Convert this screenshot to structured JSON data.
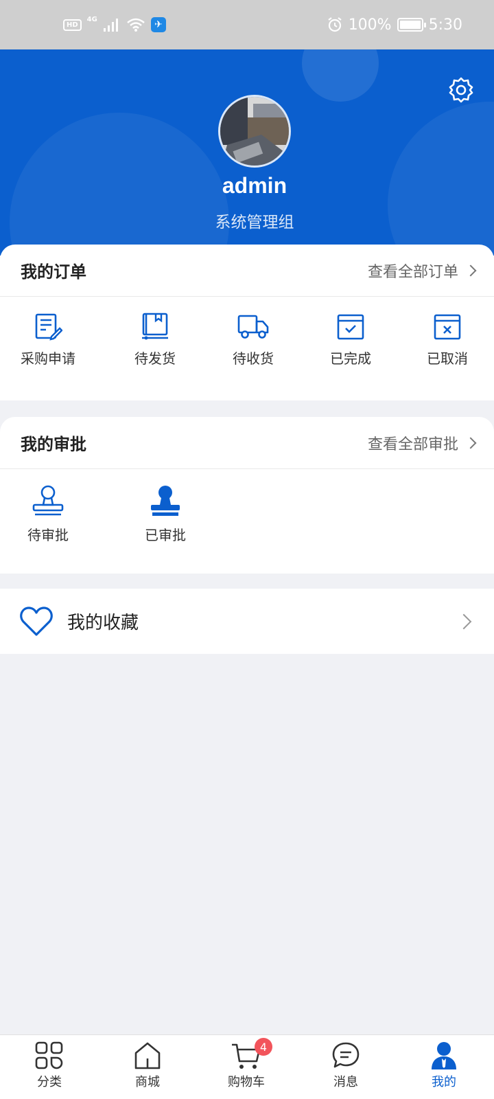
{
  "status_bar": {
    "left_badge": "HD",
    "network": "4G",
    "battery_level": "100%",
    "battery_fraction": 1.0,
    "time": "5:30"
  },
  "header": {
    "username": "admin",
    "group": "系统管理组",
    "settings_icon": "gear-icon"
  },
  "orders": {
    "title": "我的订单",
    "more_label": "查看全部订单",
    "items": [
      {
        "label": "采购申请",
        "icon": "purchase-request-icon"
      },
      {
        "label": "待发货",
        "icon": "pending-shipment-icon"
      },
      {
        "label": "待收货",
        "icon": "pending-receipt-icon"
      },
      {
        "label": "已完成",
        "icon": "completed-icon"
      },
      {
        "label": "已取消",
        "icon": "cancelled-icon"
      }
    ]
  },
  "approvals": {
    "title": "我的审批",
    "more_label": "查看全部审批",
    "items": [
      {
        "label": "待审批",
        "icon": "stamp-outline-icon"
      },
      {
        "label": "已审批",
        "icon": "stamp-filled-icon"
      }
    ]
  },
  "favorites": {
    "label": "我的收藏",
    "icon": "heart-icon"
  },
  "tabbar": {
    "items": [
      {
        "label": "分类",
        "icon": "category-grid-icon"
      },
      {
        "label": "商城",
        "icon": "home-icon"
      },
      {
        "label": "购物车",
        "icon": "cart-icon",
        "badge": "4"
      },
      {
        "label": "消息",
        "icon": "message-icon"
      },
      {
        "label": "我的",
        "icon": "user-icon",
        "active": true
      }
    ]
  },
  "colors": {
    "primary": "#0b5fce",
    "badge": "#f2545b",
    "background": "#f0f1f5"
  }
}
